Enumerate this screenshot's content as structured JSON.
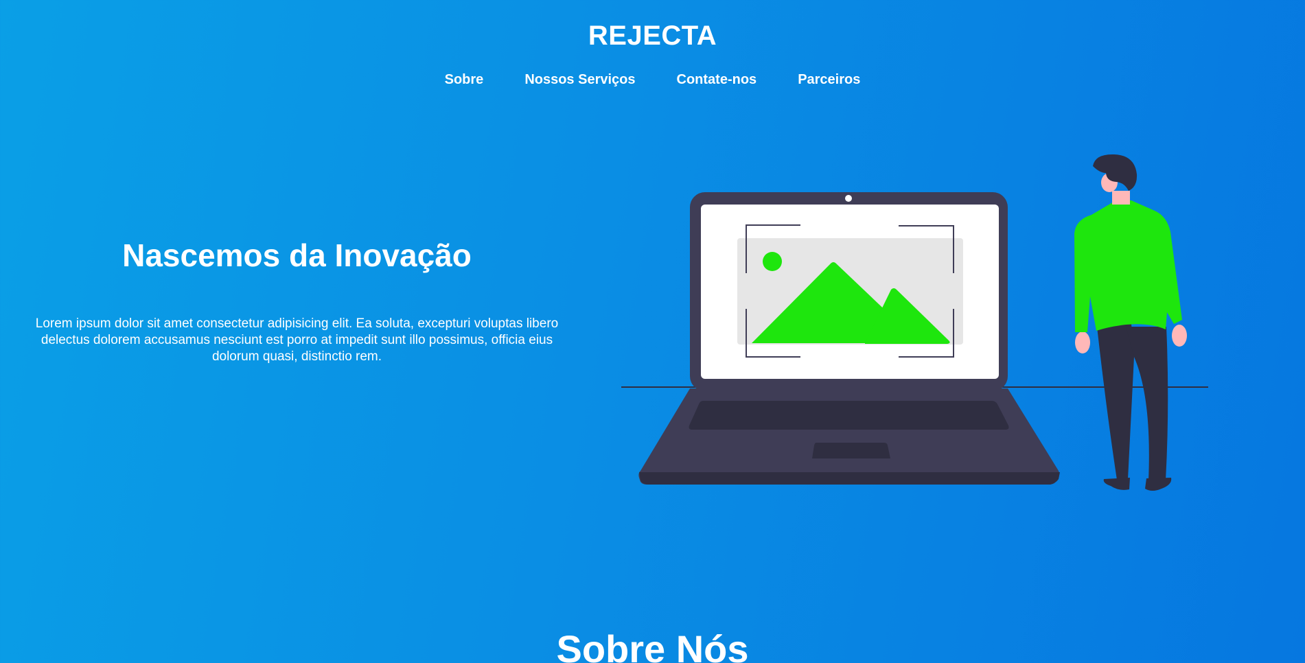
{
  "header": {
    "brand": "REJECTA",
    "nav": [
      {
        "label": "Sobre"
      },
      {
        "label": "Nossos Serviços"
      },
      {
        "label": "Contate-nos"
      },
      {
        "label": "Parceiros"
      }
    ]
  },
  "hero": {
    "title": "Nascemos da Inovação",
    "description": "Lorem ipsum dolor sit amet consectetur adipisicing elit. Ea soluta, excepturi voluptas libero delectus dolorem accusamus nesciunt est porro at impedit sunt illo possimus, officia eius dolorum quasi, distinctio rem.",
    "illustration_icon": "person-with-laptop-image-illustration"
  },
  "about": {
    "title": "Sobre Nós"
  },
  "colors": {
    "background_start": "#0a9fe6",
    "background_end": "#0677e0",
    "accent_green": "#1ee60d",
    "laptop_dark": "#3f3d56",
    "laptop_darker": "#2f2e41"
  }
}
